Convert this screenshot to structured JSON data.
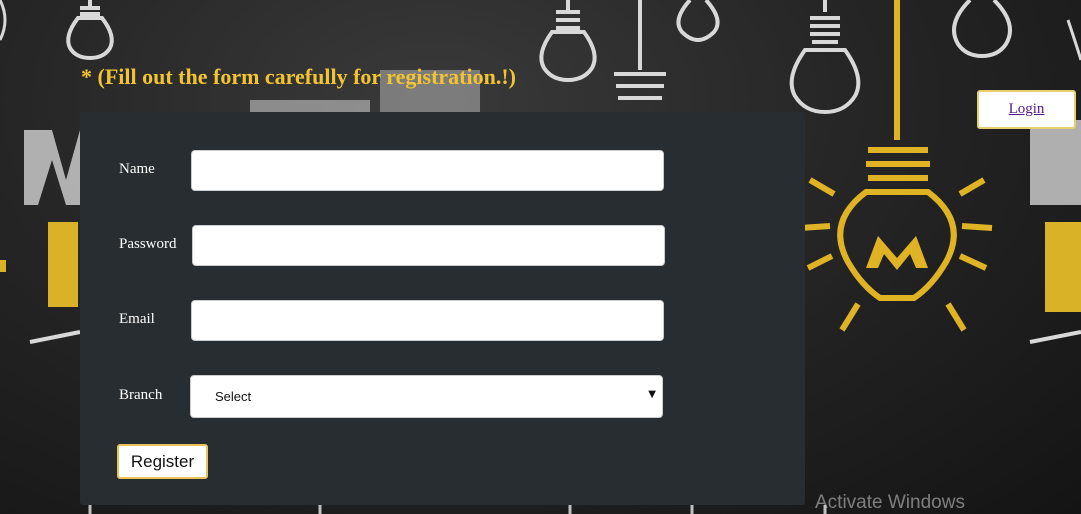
{
  "page": {
    "notice": "* (Fill out the form carefully for registration.!)",
    "login_link": "Login",
    "watermark": "Activate Windows"
  },
  "form": {
    "fields": [
      {
        "label": "Name",
        "value": "",
        "type": "text"
      },
      {
        "label": "Password",
        "value": "",
        "type": "password"
      },
      {
        "label": "Email",
        "value": "",
        "type": "email"
      }
    ],
    "branch": {
      "label": "Branch",
      "selected": "Select"
    },
    "register_label": "Register"
  },
  "colors": {
    "accent_yellow": "#f2c431",
    "panel_bg": "#272d30",
    "chalkboard": "#262626",
    "link_purple": "#551a8b"
  },
  "icons": [
    "lightbulb-icon",
    "m-logo-lightbulb-icon",
    "dropdown-caret-icon"
  ]
}
